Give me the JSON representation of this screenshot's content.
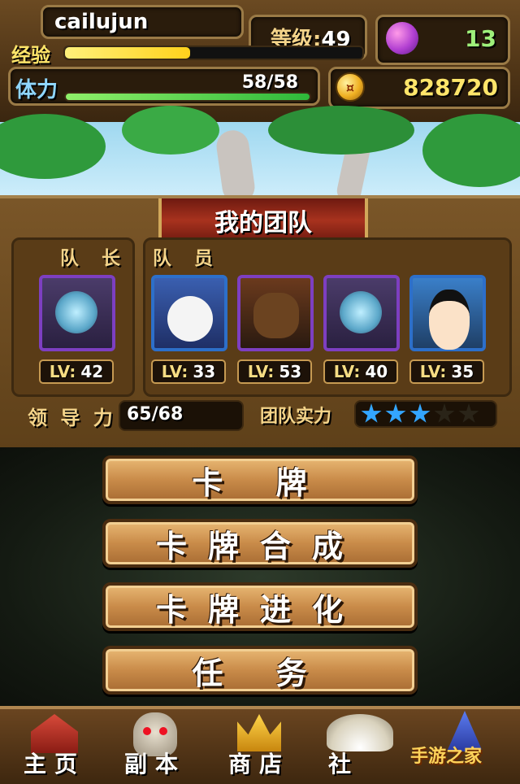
{
  "header": {
    "username": "cailujun",
    "exp_label": "经验",
    "level_label": "等级:",
    "level_value": "49",
    "exp_progress": 0.42,
    "stamina_label": "体力",
    "stamina_value": "58/58",
    "stamina_progress": 1.0,
    "gems": "13",
    "coins": "828720"
  },
  "team": {
    "title": "我的团队",
    "leader_label": "队 长",
    "members_label": "队 员",
    "lv_key": "LV:",
    "leader": {
      "level": "42"
    },
    "members": [
      {
        "level": "33"
      },
      {
        "level": "53"
      },
      {
        "level": "40"
      },
      {
        "level": "35"
      }
    ],
    "leadership_label": "领 导 力",
    "leadership_value": "65/68",
    "strength_label": "团队实力",
    "strength_stars": 3,
    "strength_max": 5
  },
  "menu": {
    "cards": "卡  牌",
    "card_fusion": "卡牌合成",
    "card_evolve": "卡牌进化",
    "quests": "任  务"
  },
  "nav": {
    "home": "主页",
    "dungeon": "副本",
    "shop": "商店",
    "social": "社"
  },
  "watermark": {
    "text": "手游之家"
  },
  "colors": {
    "accent_gold": "#f4d48a",
    "exp_bar": "#ffe34d",
    "stamina_bar": "#58d84a",
    "gem_color": "#9ef07a",
    "star_blue": "#33a6ff"
  },
  "icons": {
    "gem": "purple-gem-icon",
    "coin": "gold-coin-icon",
    "home": "house-icon",
    "dungeon": "skull-icon",
    "shop": "crown-icon",
    "social": "wings-icon",
    "wizard": "wizard-hat-icon"
  }
}
